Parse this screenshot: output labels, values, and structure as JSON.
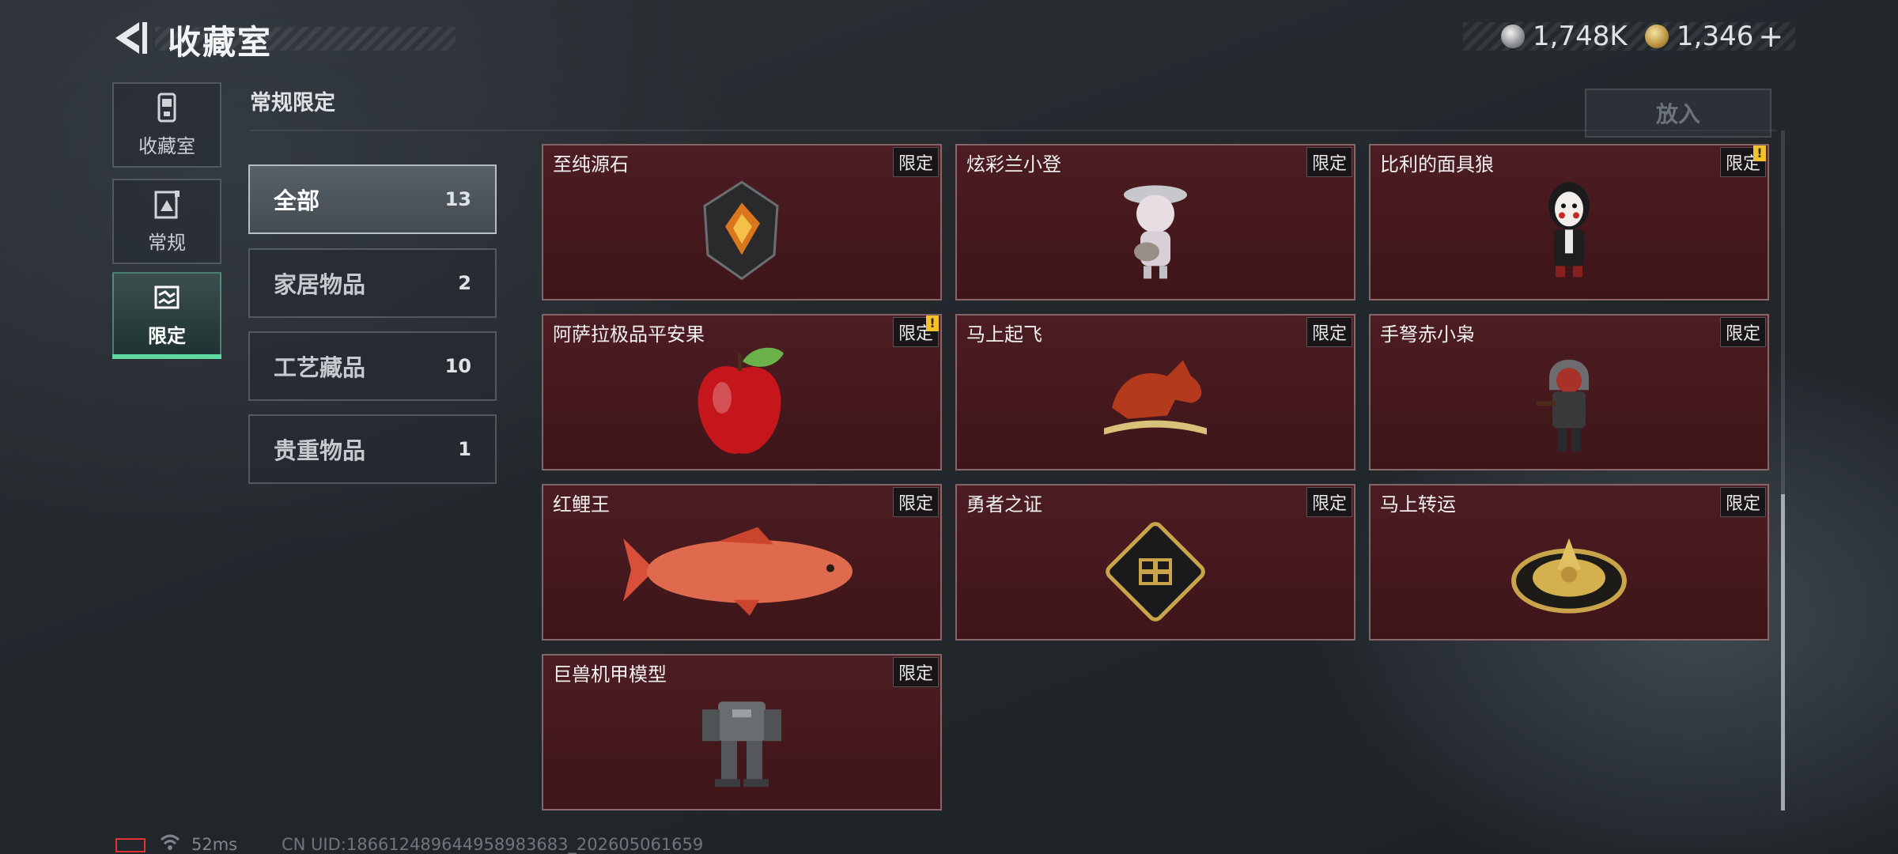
{
  "header": {
    "title": "收藏室",
    "currency": [
      {
        "icon": "silver-coin-icon",
        "value": "1,748K"
      },
      {
        "icon": "gold-coin-icon",
        "value": "1,346"
      }
    ],
    "add_label": "+"
  },
  "nav": [
    {
      "label": "收藏室",
      "icon": "collection-room-icon",
      "active": false
    },
    {
      "label": "常规",
      "icon": "regular-icon",
      "active": false
    },
    {
      "label": "限定",
      "icon": "limited-icon",
      "active": true
    }
  ],
  "section": {
    "title": "常规限定"
  },
  "put_button": "放入",
  "categories": [
    {
      "label": "全部",
      "count": "13",
      "active": true
    },
    {
      "label": "家居物品",
      "count": "2",
      "active": false
    },
    {
      "label": "工艺藏品",
      "count": "10",
      "active": false
    },
    {
      "label": "贵重物品",
      "count": "1",
      "active": false
    }
  ],
  "items": [
    {
      "name": "至纯源石",
      "tag": "限定",
      "alert": false,
      "icon": "crystal-stone-icon"
    },
    {
      "name": "炫彩兰小登",
      "tag": "限定",
      "alert": false,
      "icon": "mariachi-figure-icon"
    },
    {
      "name": "比利的面具狼",
      "tag": "限定",
      "alert": true,
      "icon": "puppet-figure-icon"
    },
    {
      "name": "阿萨拉极品平安果",
      "tag": "限定",
      "alert": true,
      "icon": "red-apple-icon"
    },
    {
      "name": "马上起飞",
      "tag": "限定",
      "alert": false,
      "icon": "horse-statue-icon"
    },
    {
      "name": "手弩赤小枭",
      "tag": "限定",
      "alert": false,
      "icon": "hooded-figure-icon"
    },
    {
      "name": "红鲤王",
      "tag": "限定",
      "alert": false,
      "icon": "red-carp-icon"
    },
    {
      "name": "勇者之证",
      "tag": "限定",
      "alert": false,
      "icon": "badge-card-icon"
    },
    {
      "name": "马上转运",
      "tag": "限定",
      "alert": false,
      "icon": "golden-compass-icon"
    },
    {
      "name": "巨兽机甲模型",
      "tag": "限定",
      "alert": false,
      "icon": "mech-model-icon"
    }
  ],
  "alert_mark": "!",
  "footer": {
    "ping": "52ms",
    "uid": "CN UID:18661248964495898368­3_202605061659"
  }
}
